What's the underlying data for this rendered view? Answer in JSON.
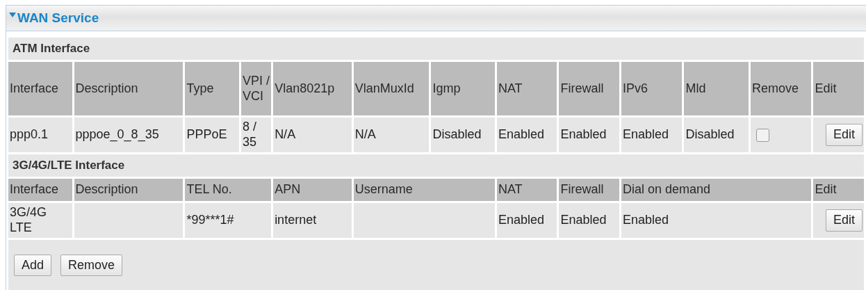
{
  "panel": {
    "title": "WAN Service",
    "expanded": true
  },
  "atm": {
    "title": "ATM Interface",
    "columns": [
      "Interface",
      "Description",
      "Type",
      "VPI / VCI",
      "Vlan8021p",
      "VlanMuxId",
      "Igmp",
      "NAT",
      "Firewall",
      "IPv6",
      "Mld",
      "Remove",
      "Edit"
    ],
    "rows": [
      {
        "cells": [
          {
            "kind": "text",
            "text": "ppp0.1"
          },
          {
            "kind": "text",
            "text": "pppoe_0_8_35"
          },
          {
            "kind": "text",
            "text": "PPPoE"
          },
          {
            "kind": "text",
            "text": "8 / 35"
          },
          {
            "kind": "text",
            "text": "N/A"
          },
          {
            "kind": "text",
            "text": "N/A"
          },
          {
            "kind": "text",
            "text": "Disabled"
          },
          {
            "kind": "text",
            "text": "Enabled"
          },
          {
            "kind": "text",
            "text": "Enabled"
          },
          {
            "kind": "text",
            "text": "Enabled"
          },
          {
            "kind": "text",
            "text": "Disabled"
          },
          {
            "kind": "checkbox",
            "checked": false
          },
          {
            "kind": "button",
            "label": "Edit"
          }
        ]
      }
    ]
  },
  "lte": {
    "title": "3G/4G/LTE Interface",
    "columns": [
      {
        "label": "Interface"
      },
      {
        "label": "Description"
      },
      {
        "label": "TEL No.",
        "colspan": 2
      },
      {
        "label": "APN"
      },
      {
        "label": "Username",
        "colspan": 2
      },
      {
        "label": "NAT"
      },
      {
        "label": "Firewall"
      },
      {
        "label": "Dial on demand",
        "colspan": 3
      },
      {
        "label": "Edit"
      }
    ],
    "rows": [
      {
        "cells": [
          {
            "kind": "text",
            "text": "3G/4G LTE"
          },
          {
            "kind": "empty"
          },
          {
            "kind": "text",
            "text": "*99***1#",
            "colspan": 2
          },
          {
            "kind": "text",
            "text": "internet"
          },
          {
            "kind": "empty",
            "colspan": 2
          },
          {
            "kind": "text",
            "text": "Enabled"
          },
          {
            "kind": "text",
            "text": "Enabled"
          },
          {
            "kind": "text",
            "text": "Enabled",
            "colspan": 3
          },
          {
            "kind": "button",
            "label": "Edit"
          }
        ]
      }
    ]
  },
  "buttons": [
    "Add",
    "Remove"
  ]
}
